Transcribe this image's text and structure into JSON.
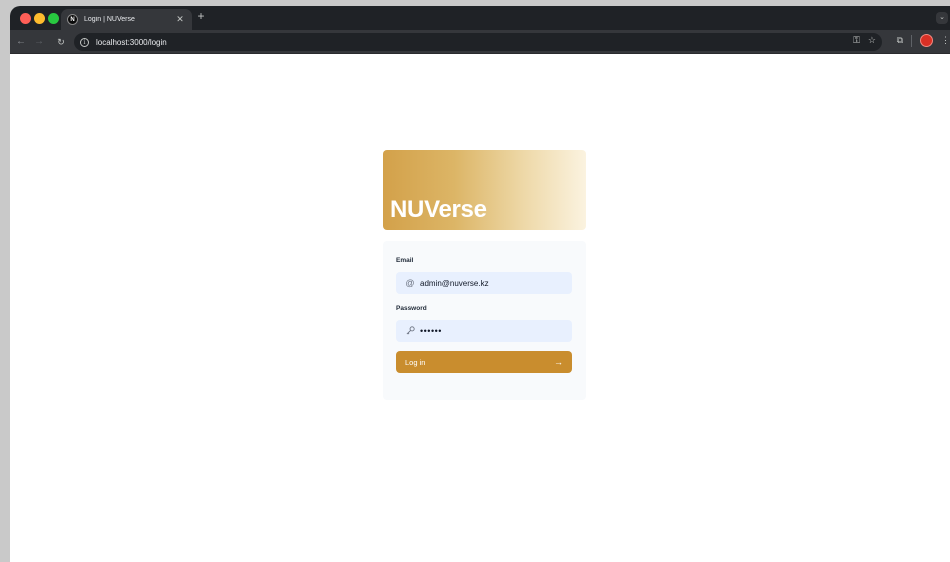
{
  "browser": {
    "tab_title": "Login | NUVerse",
    "favicon_letter": "N",
    "url": "localhost:3000/login"
  },
  "hero": {
    "title": "NUVerse"
  },
  "form": {
    "email_label": "Email",
    "email_value": "admin@nuverse.kz",
    "password_label": "Password",
    "password_value": "••••••",
    "login_label": "Log in"
  },
  "icons": {
    "email": "at-icon",
    "password": "key-icon",
    "submit": "arrow-right-icon"
  },
  "colors": {
    "accent": "#c98d2e",
    "field_bg": "#e8f0fe",
    "card_bg": "#f8fafc"
  }
}
